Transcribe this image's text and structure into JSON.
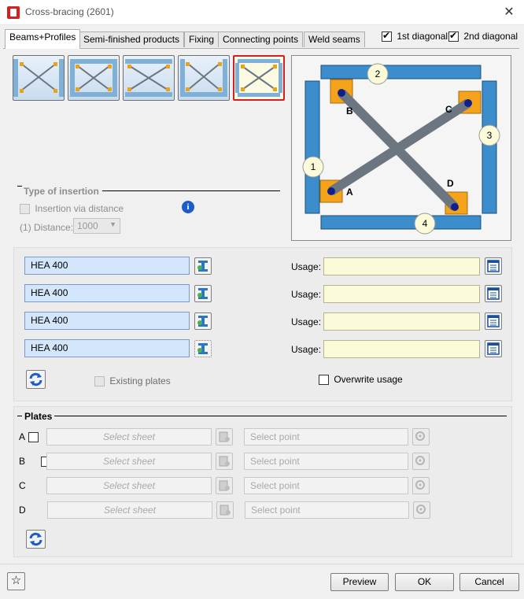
{
  "window": {
    "title": "Cross-bracing (2601)",
    "close_glyph": "✕"
  },
  "tabs": [
    {
      "label": "Beams+Profiles",
      "active": true
    },
    {
      "label": "Semi-finished products",
      "active": false
    },
    {
      "label": "Fixing",
      "active": false
    },
    {
      "label": "Connecting points",
      "active": false
    },
    {
      "label": "Weld seams",
      "active": false
    }
  ],
  "diagonals": {
    "first": {
      "label": "1st diagonal",
      "checked": true
    },
    "second": {
      "label": "2nd diagonal",
      "checked": true
    }
  },
  "variants": {
    "count": 5,
    "selected_index": 4
  },
  "preview": {
    "beam_labels": [
      "1",
      "2",
      "3",
      "4"
    ],
    "point_labels": [
      "A",
      "B",
      "C",
      "D"
    ],
    "colors": {
      "beam": "#3c8dcc",
      "plate": "#f5a31a",
      "diagonal": "#6b7680",
      "point": "#10208a"
    }
  },
  "insertion": {
    "title": "Type of insertion",
    "via_distance_label": "Insertion via distance",
    "distance_label": "(1) Distance:",
    "distance_value": "1000",
    "info_icon": "info-icon"
  },
  "profiles": [
    {
      "value": "HEA 400",
      "usage_label": "Usage:",
      "usage_value": ""
    },
    {
      "value": "HEA 400",
      "usage_label": "Usage:",
      "usage_value": ""
    },
    {
      "value": "HEA 400",
      "usage_label": "Usage:",
      "usage_value": ""
    },
    {
      "value": "HEA 400",
      "usage_label": "Usage:",
      "usage_value": ""
    }
  ],
  "existing_plates_label": "Existing plates",
  "overwrite_usage_label": "Overwrite usage",
  "plates": {
    "title": "Plates",
    "rows": [
      {
        "letter": "A",
        "sheet_placeholder": "Select sheet",
        "point_placeholder": "Select point"
      },
      {
        "letter": "B",
        "sheet_placeholder": "Select sheet",
        "point_placeholder": "Select point"
      },
      {
        "letter": "C",
        "sheet_placeholder": "Select sheet",
        "point_placeholder": "Select point"
      },
      {
        "letter": "D",
        "sheet_placeholder": "Select sheet",
        "point_placeholder": "Select point"
      }
    ]
  },
  "footer": {
    "preview_label": "Preview",
    "ok_label": "OK",
    "cancel_label": "Cancel"
  }
}
